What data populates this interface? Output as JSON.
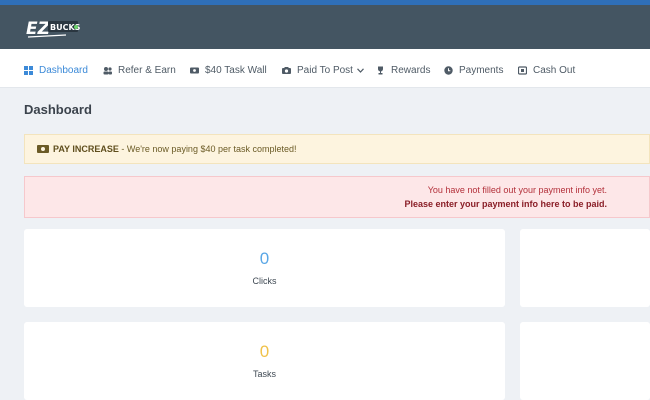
{
  "brand": {
    "logo_text": "EZ BUCKS",
    "colors": {
      "header": "#445562",
      "accent": "#3c8ad8",
      "stripe": "#2f6fb8"
    }
  },
  "nav": {
    "items": [
      {
        "label": "Dashboard",
        "icon": "grid-icon",
        "active": true
      },
      {
        "label": "Refer & Earn",
        "icon": "users-icon"
      },
      {
        "label": "$40 Task Wall",
        "icon": "money-icon"
      },
      {
        "label": "Paid To Post",
        "icon": "camera-icon",
        "has_dropdown": true
      },
      {
        "label": "Rewards",
        "icon": "trophy-icon"
      },
      {
        "label": "Payments",
        "icon": "clock-icon"
      },
      {
        "label": "Cash Out",
        "icon": "wallet-icon"
      }
    ]
  },
  "page": {
    "title": "Dashboard"
  },
  "alerts": {
    "pay_increase": {
      "strong": "PAY INCREASE",
      "text": " - We're now paying $40 per task completed!"
    },
    "payment_info": {
      "line1": "You have not filled out your payment info yet.",
      "line2": "Please enter your payment info here to be paid."
    }
  },
  "stats": [
    {
      "value": "0",
      "label": "Clicks",
      "color": "#5aa7e6"
    },
    {
      "value": "0",
      "label": "Tasks",
      "color": "#f0c24a"
    }
  ]
}
